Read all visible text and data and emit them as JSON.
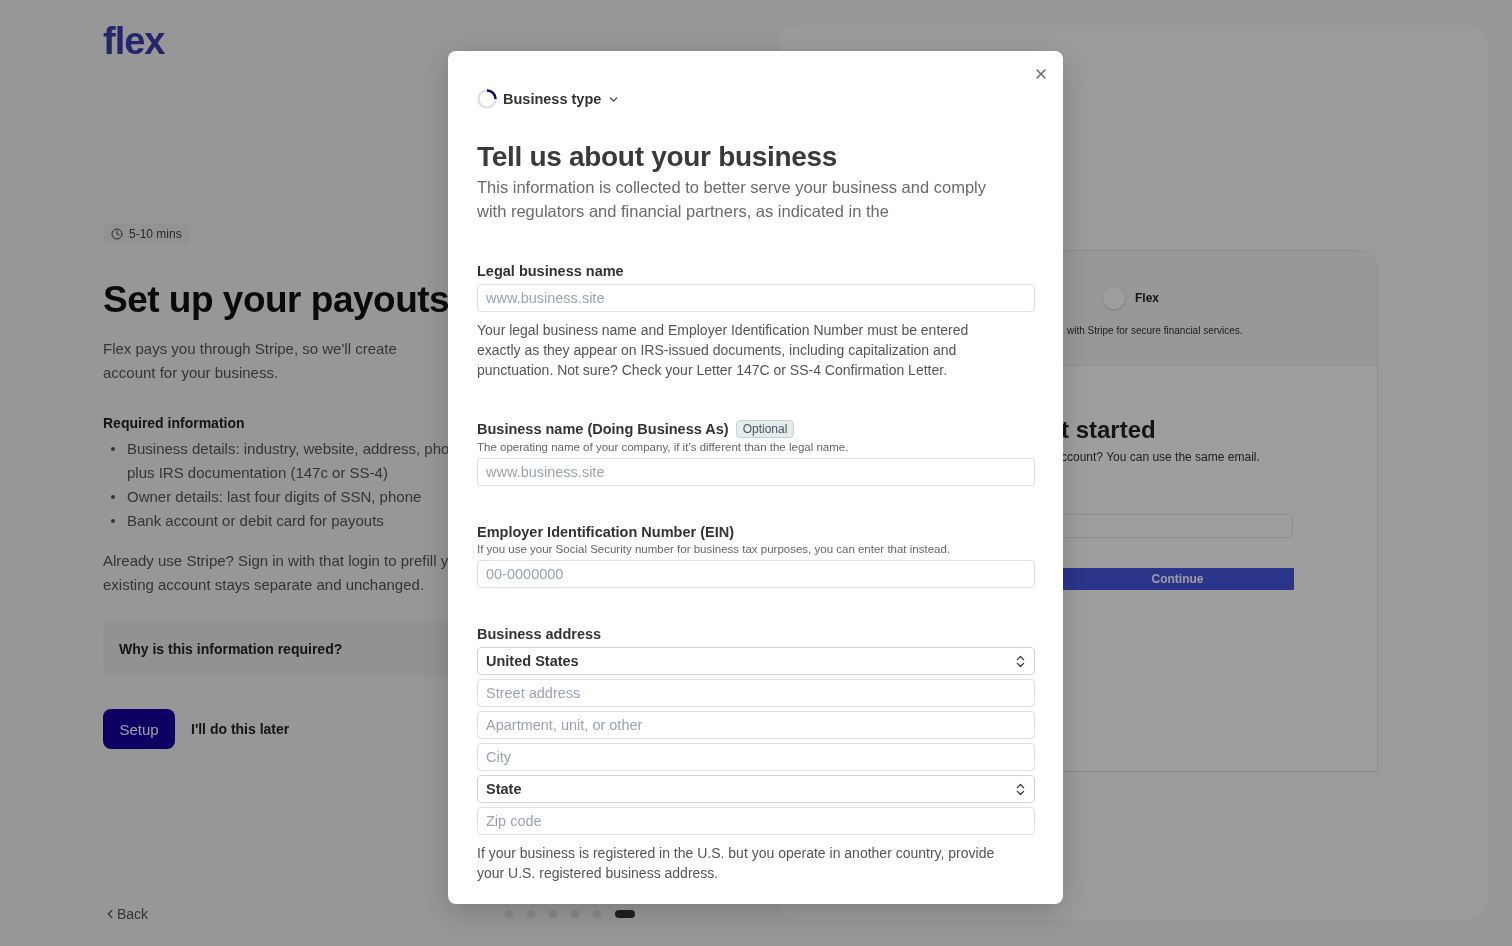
{
  "background": {
    "logo": "flex",
    "duration": "5-10 mins",
    "heading": "Set up your payouts",
    "intro": [
      "Flex pays you through Stripe, so we'll create",
      "account for your business."
    ],
    "required_title": "Required information",
    "bullets": [
      {
        "lines": [
          "Business details: industry, website, address, pho",
          "plus IRS documentation (147c or SS-4)"
        ]
      },
      {
        "lines": [
          "Owner details: last four digits of SSN, phone"
        ]
      },
      {
        "lines": [
          "Bank account or debit card for payouts"
        ]
      }
    ],
    "already": [
      "Already use Stripe? Sign in with that login to prefill y",
      "existing account stays separate and unchanged."
    ],
    "accordion": "Why is this information required?",
    "setup_button": "Setup",
    "later_link": "I'll do this later",
    "back_link": "Back",
    "pager": [
      {
        "selected": false
      },
      {
        "selected": false
      },
      {
        "selected": false
      },
      {
        "selected": false
      },
      {
        "selected": false
      },
      {
        "selected": true
      }
    ],
    "preview": {
      "brand": "Flex",
      "tagline": "with Stripe for secure financial services.",
      "heading": "t started",
      "subtext": "ccount? You can use the same email.",
      "continue_button": "Continue"
    }
  },
  "modal": {
    "step": "Business type",
    "title": "Tell us about your business",
    "intro": "This information is collected to better serve your business and comply with regulators and financial partners, as indicated in the",
    "fields": [
      {
        "kind": "text",
        "label": "Legal business name",
        "placeholder": "www.business.site",
        "help": "Your legal business name and Employer Identification Number must be entered exactly as they appear on IRS-issued documents, including capitalization and punctuation. Not sure? Check your Letter 147C or SS-4 Confirmation Letter."
      },
      {
        "kind": "text",
        "label": "Business name (Doing Business As)",
        "badge": "Optional",
        "hint": "The operating name of your company, if it’s different than the legal name.",
        "placeholder": "www.business.site"
      },
      {
        "kind": "text",
        "label": "Employer Identification Number (EIN)",
        "hint": "If you use your Social Security number for business tax purposes, you can enter that instead.",
        "placeholder": "00-0000000"
      },
      {
        "kind": "address",
        "label": "Business address",
        "inputs": [
          {
            "kind": "select",
            "value": "United States"
          },
          {
            "kind": "text",
            "placeholder": "Street address"
          },
          {
            "kind": "text",
            "placeholder": "Apartment, unit, or other"
          },
          {
            "kind": "text",
            "placeholder": "City"
          },
          {
            "kind": "select",
            "value": "State"
          },
          {
            "kind": "text",
            "placeholder": "Zip code"
          }
        ],
        "help": "If your business is registered in the U.S. but you operate in another country, provide your U.S. registered business address."
      }
    ]
  }
}
